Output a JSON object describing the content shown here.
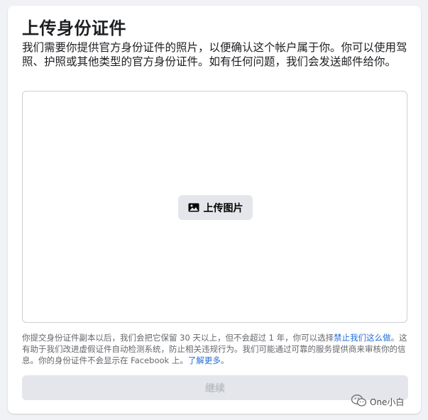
{
  "dialog": {
    "title": "上传身份证件",
    "description": "我们需要你提供官方身份证件的照片，以便确认这个帐户属于你。你可以使用驾照、护照或其他类型的官方身份证件。如有任何问题，我们会发送邮件给你。",
    "upload_button": {
      "label": "上传图片",
      "icon": "image-icon"
    },
    "fine_print": {
      "part1": "你提交身份证件副本以后，我们会把它保留 30 天以上，但不会超过 1 年，你可以选择",
      "link1": "禁止我们这么做",
      "part2": "。这有助于我们改进虚假证件自动检测系统，防止相关违规行为。我们可能通过可靠的服务提供商来审核你的信息。你的身份证件不会显示在 Facebook 上。",
      "link2": "了解更多",
      "part3": "。"
    },
    "continue_button": {
      "label": "继续",
      "disabled": true
    }
  },
  "watermark": {
    "text": "One小白",
    "icon": "wechat-icon"
  },
  "colors": {
    "background": "#f0f2f5",
    "card": "#ffffff",
    "button_gray": "#e4e6eb",
    "link": "#216fdb",
    "muted_text": "#65676b",
    "disabled_text": "#bcc0c4"
  }
}
